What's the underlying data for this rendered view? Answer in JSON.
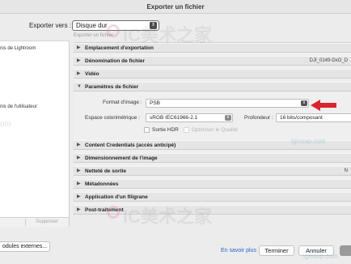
{
  "window": {
    "title": "Exporter un fichier"
  },
  "export_to": {
    "label": "Exporter vers :",
    "value": "Disque dur",
    "hint": "Exporter un fichier"
  },
  "left_panel": {
    "items": [
      "nis de Lightroom",
      "nis de l'utilisateur"
    ],
    "remove_label": "Supprimer",
    "modules_button": "odules externes..."
  },
  "sections": [
    {
      "title": "Emplacement d'exportation",
      "expanded": false,
      "right": ""
    },
    {
      "title": "Dénomination de fichier",
      "expanded": false,
      "right": "DJI_0149-DxO_D"
    },
    {
      "title": "Vidéo",
      "expanded": false,
      "right": ""
    },
    {
      "title": "Paramètres de fichier",
      "expanded": true,
      "right": ""
    },
    {
      "title": "Content Credentials (accès anticipé)",
      "expanded": false,
      "right": ""
    },
    {
      "title": "Dimensionnement de l'image",
      "expanded": false,
      "right": ""
    },
    {
      "title": "Netteté de sortie",
      "expanded": false,
      "right": "N"
    },
    {
      "title": "Métadonnées",
      "expanded": false,
      "right": ""
    },
    {
      "title": "Application d'un filigrane",
      "expanded": false,
      "right": ""
    },
    {
      "title": "Post-traitement",
      "expanded": false,
      "right": ""
    }
  ],
  "file_settings": {
    "format_label": "Format d'image :",
    "format_value": "PSB",
    "colorspace_label": "Espace colorimétrique :",
    "colorspace_value": "sRGB IEC61966-2.1",
    "depth_label": "Profondeur :",
    "depth_value": "16 bits/composant",
    "hdr_label": "Sortie HDR",
    "hdr_checked": false,
    "optimize_label": "Optimiser le Qualité",
    "optimize_checked": false
  },
  "footer": {
    "learn_more": "En savoir plus",
    "done": "Terminer",
    "cancel": "Annuler"
  },
  "watermark": {
    "text": "IC美术之家",
    "small": "igmsxp.com",
    "left_edge": "om"
  },
  "colors": {
    "accent_arrow": "#d8262c",
    "link": "#2a62c9"
  }
}
